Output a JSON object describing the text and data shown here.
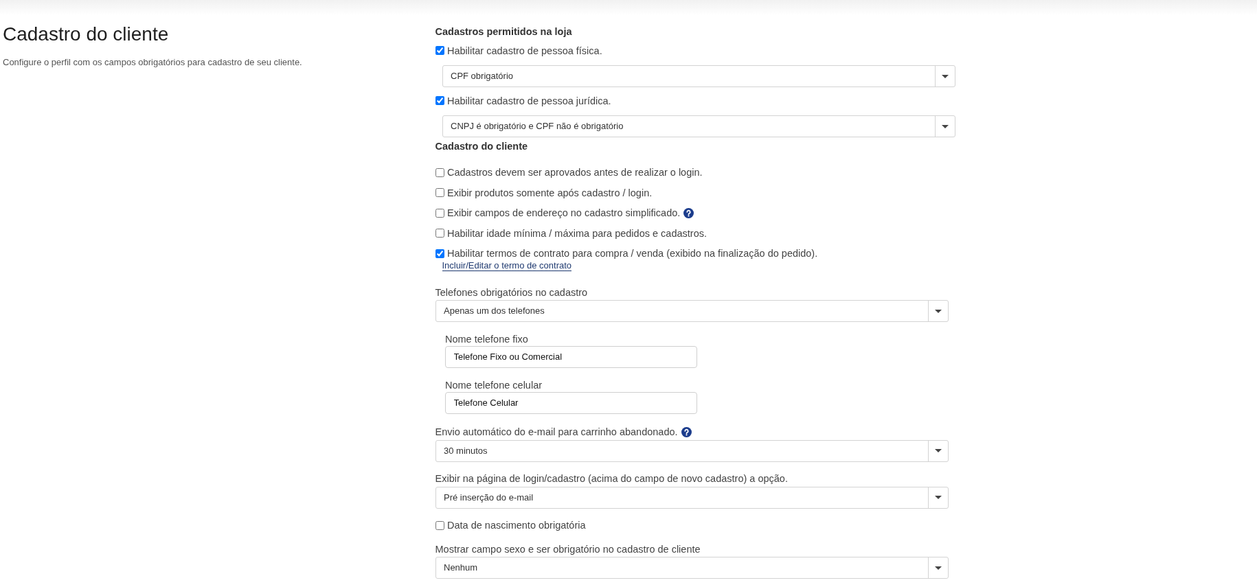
{
  "header": {
    "title": "Cadastro do cliente",
    "description": "Configure o perfil com os campos obrigatórios para cadastro de seu cliente."
  },
  "sections": [
    {
      "heading": "Cadastros permitidos na loja",
      "items": [
        {
          "kind": "checkbox",
          "label": "Habilitar cadastro de pessoa física.",
          "checked": true,
          "dropdown": {
            "value": "CPF obrigatório"
          }
        },
        {
          "kind": "checkbox",
          "label": "Habilitar cadastro de pessoa jurídica.",
          "checked": true,
          "dropdown": {
            "value": "CNPJ é obrigatório e CPF não é obrigatório"
          }
        }
      ]
    },
    {
      "heading": "Cadastro do cliente",
      "items": [
        {
          "kind": "checkbox",
          "label": "Cadastros devem ser aprovados antes de realizar o login.",
          "checked": false
        },
        {
          "kind": "checkbox",
          "label": "Exibir produtos somente após cadastro / login.",
          "checked": false
        },
        {
          "kind": "checkbox",
          "label": "Exibir campos de endereço no cadastro simplificado.",
          "checked": false,
          "help": true
        },
        {
          "kind": "checkbox",
          "label": "Habilitar idade mínima / máxima para pedidos e cadastros.",
          "checked": false
        },
        {
          "kind": "checkbox",
          "label": "Habilitar termos de contrato para compra / venda (exibido na finalização do pedido).",
          "checked": true,
          "link": "Incluir/Editar o termo de contrato"
        },
        {
          "kind": "select",
          "label": "Telefones obrigatórios no cadastro",
          "value": "Apenas um dos telefones",
          "fields": [
            {
              "label": "Nome telefone fixo",
              "value": "Telefone Fixo ou Comercial"
            },
            {
              "label": "Nome telefone celular",
              "value": "Telefone Celular"
            }
          ]
        },
        {
          "kind": "select",
          "label": "Envio automático do e-mail para carrinho abandonado.",
          "value": "30 minutos",
          "help": true
        },
        {
          "kind": "select",
          "label": "Exibir na página de login/cadastro (acima do campo de novo cadastro) a opção.",
          "value": "Pré inserção do e-mail"
        },
        {
          "kind": "checkbox",
          "label": "Data de nascimento obrigatória",
          "checked": false
        },
        {
          "kind": "select",
          "label": "Mostrar campo sexo e ser obrigatório no cadastro de cliente",
          "value": "Nenhum"
        }
      ]
    }
  ]
}
